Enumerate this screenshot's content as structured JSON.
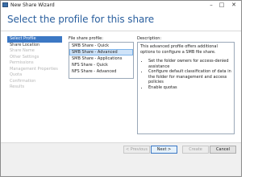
{
  "window": {
    "title": "New Share Wizard",
    "minimize_glyph": "–",
    "maximize_glyph": "□",
    "close_glyph": "✕"
  },
  "page_heading": "Select the profile for this share",
  "nav": {
    "items": [
      {
        "label": "Select Profile",
        "state": "active"
      },
      {
        "label": "Share Location",
        "state": "done"
      },
      {
        "label": "Share Name",
        "state": "pending"
      },
      {
        "label": "Other Settings",
        "state": "pending"
      },
      {
        "label": "Permissions",
        "state": "pending"
      },
      {
        "label": "Management Properties",
        "state": "pending"
      },
      {
        "label": "Quota",
        "state": "pending"
      },
      {
        "label": "Confirmation",
        "state": "pending"
      },
      {
        "label": "Results",
        "state": "pending"
      }
    ]
  },
  "profile_list": {
    "label": "File share profile:",
    "items": [
      {
        "label": "SMB Share - Quick",
        "selected": false
      },
      {
        "label": "SMB Share - Advanced",
        "selected": true
      },
      {
        "label": "SMB Share - Applications",
        "selected": false
      },
      {
        "label": "NFS Share - Quick",
        "selected": false
      },
      {
        "label": "NFS Share - Advanced",
        "selected": false
      }
    ]
  },
  "description": {
    "label": "Description:",
    "text": "This advanced profile offers additional options to configure a SMB file share.",
    "bullets": [
      "Set the folder owners for access-denied assistance",
      "Configure default classification of data in the folder for management and access policies",
      "Enable quotas"
    ]
  },
  "buttons": {
    "previous": "< Previous",
    "next": "Next >",
    "create": "Create",
    "cancel": "Cancel"
  },
  "colors": {
    "accent": "#3c78c4",
    "heading": "#2a5f9e",
    "selection": "#cfe3f8"
  }
}
